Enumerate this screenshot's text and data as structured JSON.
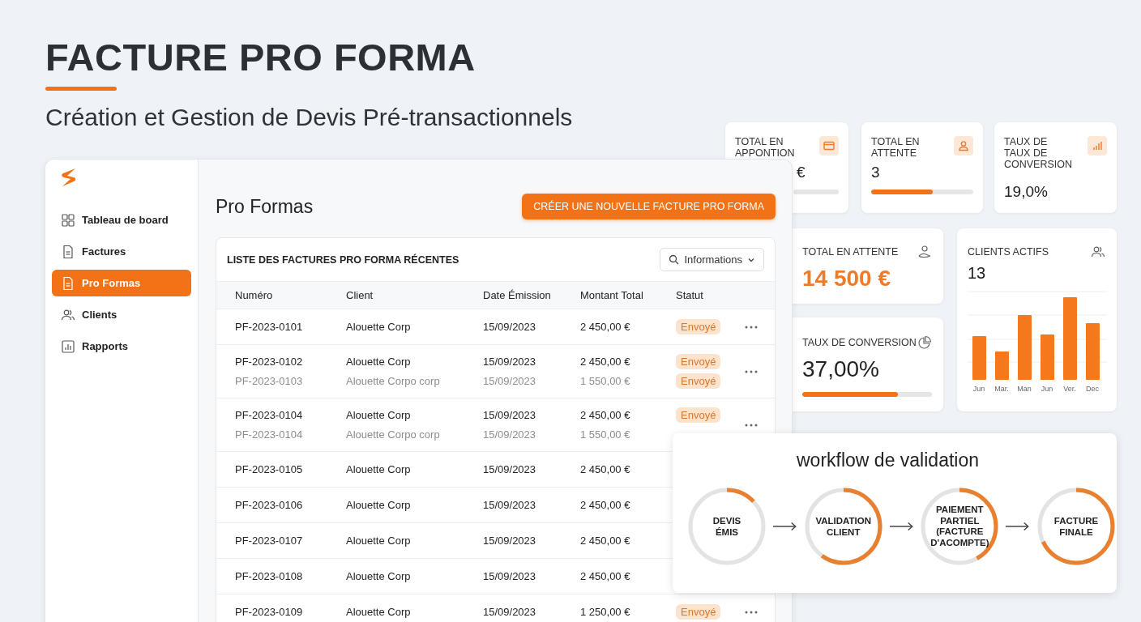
{
  "header": {
    "title": "FACTURE PRO FORMA",
    "subtitle": "Création et Gestion de Devis Pré-transactionnels"
  },
  "top_stats": [
    {
      "label": "TOTAL EN APPONTION",
      "value": "€",
      "kind": "bar"
    },
    {
      "label": "TOTAL EN ATTENTE",
      "value": "3",
      "kind": "bar",
      "level": 0.6
    },
    {
      "label": "TAUX DE TAUX DE CONVERSION",
      "value": "19,0%",
      "kind": "plain"
    }
  ],
  "app": {
    "sidebar": {
      "items": [
        {
          "label": "Tableau de board",
          "selected": false
        },
        {
          "label": "Factures",
          "selected": false
        },
        {
          "label": "Pro Formas",
          "selected": true
        },
        {
          "label": "Clients",
          "selected": false
        },
        {
          "label": "Rapports",
          "selected": false
        }
      ]
    },
    "page_title": "Pro Formas",
    "create_button": "CRÉER UNE NOUVELLE FACTURE PRO FORMA",
    "table": {
      "title": "LISTE DES FACTURES PRO FORMA RÉCENTES",
      "filter": "Informations",
      "columns": [
        "Numéro",
        "Client",
        "Date Émission",
        "Montant Total",
        "Statut"
      ],
      "rows": [
        {
          "entries": [
            {
              "number": "PF-2023-0101",
              "client": "Alouette Corp",
              "date": "15/09/2023",
              "amount": "2 450,00 €",
              "status": "Envoyé",
              "muted": false
            }
          ]
        },
        {
          "entries": [
            {
              "number": "PF-2023-0102",
              "client": "Alouette Corp",
              "date": "15/09/2023",
              "amount": "2 450,00 €",
              "status": "Envoyé",
              "muted": false
            },
            {
              "number": "PF-2023-0103",
              "client": "Alouette Corpo corp",
              "date": "15/09/2023",
              "amount": "1 550,00 €",
              "status": "Envoyé",
              "muted": true
            }
          ]
        },
        {
          "entries": [
            {
              "number": "PF-2023-0104",
              "client": "Alouette Corp",
              "date": "15/09/2023",
              "amount": "2 450,00 €",
              "status": "Envoyé",
              "muted": false
            },
            {
              "number": "PF-2023-0104",
              "client": "Alouette Corpo corp",
              "date": "15/09/2023",
              "amount": "1 550,00 €",
              "muted": true
            }
          ]
        },
        {
          "entries": [
            {
              "number": "PF-2023-0105",
              "client": "Alouette Corp",
              "date": "15/09/2023",
              "amount": "2 450,00 €",
              "muted": false
            }
          ]
        },
        {
          "entries": [
            {
              "number": "PF-2023-0106",
              "client": "Alouette Corp",
              "date": "15/09/2023",
              "amount": "2 450,00 €",
              "muted": false
            }
          ]
        },
        {
          "entries": [
            {
              "number": "PF-2023-0107",
              "client": "Alouette Corp",
              "date": "15/09/2023",
              "amount": "2 450,00 €",
              "muted": false
            }
          ]
        },
        {
          "entries": [
            {
              "number": "PF-2023-0108",
              "client": "Alouette Corp",
              "date": "15/09/2023",
              "amount": "2 450,00 €",
              "muted": false
            }
          ]
        },
        {
          "entries": [
            {
              "number": "PF-2023-0109",
              "client": "Alouette Corp",
              "date": "15/09/2023",
              "amount": "1 250,00 €",
              "status": "Envoyé",
              "muted": false
            }
          ]
        }
      ]
    }
  },
  "pending": {
    "label": "TOTAL EN ATTENTE",
    "value": "14 500 €"
  },
  "conversion": {
    "label": "TAUX DE CONVERSION",
    "value": "37,00%",
    "level": 0.74
  },
  "clients": {
    "label": "CLIENTS ACTIFS",
    "value": "13",
    "months": [
      "Jun",
      "Mar.",
      "Man",
      "Jun",
      "Ver.",
      "Dec"
    ]
  },
  "workflow": {
    "title": "workflow de validation",
    "steps": [
      {
        "label": "DEVIS\nÉMIS",
        "level": 0.13
      },
      {
        "label": "VALIDATION\nCLIENT",
        "level": 0.6
      },
      {
        "label": "PAIEMENT\nPARTIEL\n(FACTURE\nD'ACOMPTE)",
        "level": 0.42
      },
      {
        "label": "FACTURE\nFINALE",
        "level": 0.68
      }
    ]
  }
}
